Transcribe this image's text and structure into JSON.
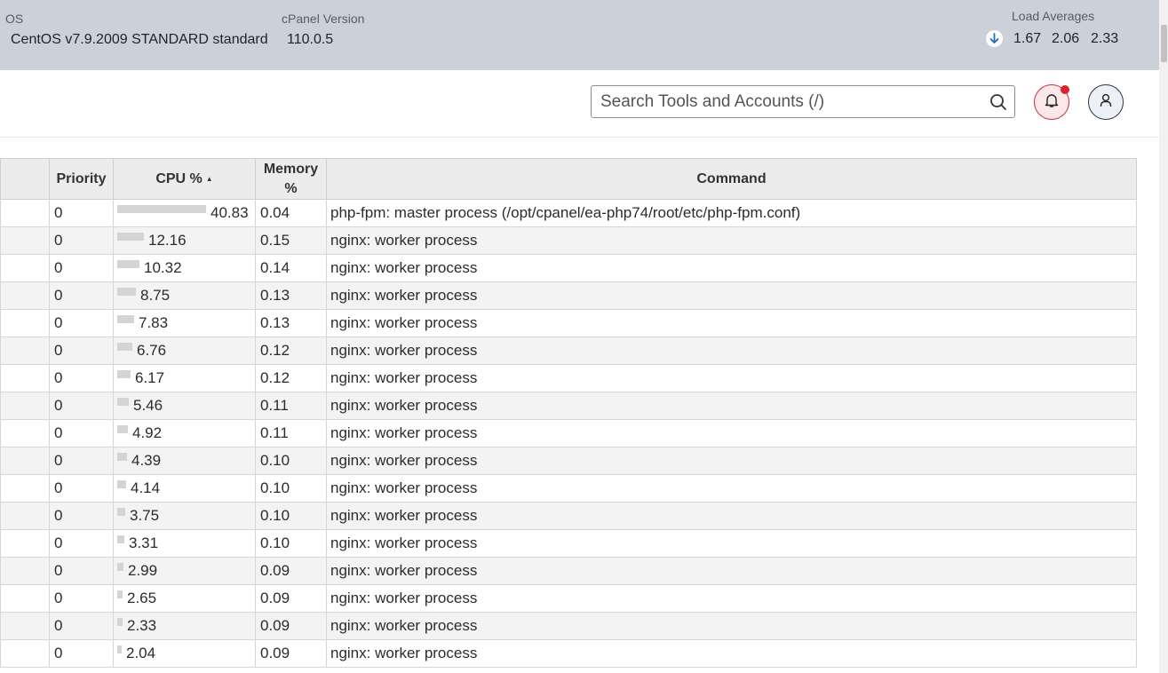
{
  "system": {
    "os_label": "OS",
    "os_value": "CentOS v7.9.2009 STANDARD standard",
    "cpanel_label": "cPanel Version",
    "cpanel_value": "110.0.5",
    "load_label": "Load Averages",
    "load_values": [
      "1.67",
      "2.06",
      "2.33"
    ],
    "load_trend_icon": "arrow-down-icon"
  },
  "header": {
    "search_placeholder": "Search Tools and Accounts (/)",
    "search_icon": "search-icon",
    "notifications_icon": "bell-icon",
    "user_icon": "user-icon"
  },
  "table": {
    "headers": {
      "priority": "Priority",
      "cpu": "CPU %",
      "cpu_sort_indicator": "▲",
      "memory": "Memory %",
      "command": "Command"
    },
    "rows": [
      {
        "priority": "0",
        "cpu": 40.83,
        "cpu_text": "40.83",
        "memory": "0.04",
        "command": "php-fpm: master process (/opt/cpanel/ea-php74/root/etc/php-fpm.conf)"
      },
      {
        "priority": "0",
        "cpu": 12.16,
        "cpu_text": "12.16",
        "memory": "0.15",
        "command": "nginx: worker process"
      },
      {
        "priority": "0",
        "cpu": 10.32,
        "cpu_text": "10.32",
        "memory": "0.14",
        "command": "nginx: worker process"
      },
      {
        "priority": "0",
        "cpu": 8.75,
        "cpu_text": "8.75",
        "memory": "0.13",
        "command": "nginx: worker process"
      },
      {
        "priority": "0",
        "cpu": 7.83,
        "cpu_text": "7.83",
        "memory": "0.13",
        "command": "nginx: worker process"
      },
      {
        "priority": "0",
        "cpu": 6.76,
        "cpu_text": "6.76",
        "memory": "0.12",
        "command": "nginx: worker process"
      },
      {
        "priority": "0",
        "cpu": 6.17,
        "cpu_text": "6.17",
        "memory": "0.12",
        "command": "nginx: worker process"
      },
      {
        "priority": "0",
        "cpu": 5.46,
        "cpu_text": "5.46",
        "memory": "0.11",
        "command": "nginx: worker process"
      },
      {
        "priority": "0",
        "cpu": 4.92,
        "cpu_text": "4.92",
        "memory": "0.11",
        "command": "nginx: worker process"
      },
      {
        "priority": "0",
        "cpu": 4.39,
        "cpu_text": "4.39",
        "memory": "0.10",
        "command": "nginx: worker process"
      },
      {
        "priority": "0",
        "cpu": 4.14,
        "cpu_text": "4.14",
        "memory": "0.10",
        "command": "nginx: worker process"
      },
      {
        "priority": "0",
        "cpu": 3.75,
        "cpu_text": "3.75",
        "memory": "0.10",
        "command": "nginx: worker process"
      },
      {
        "priority": "0",
        "cpu": 3.31,
        "cpu_text": "3.31",
        "memory": "0.10",
        "command": "nginx: worker process"
      },
      {
        "priority": "0",
        "cpu": 2.99,
        "cpu_text": "2.99",
        "memory": "0.09",
        "command": "nginx: worker process"
      },
      {
        "priority": "0",
        "cpu": 2.65,
        "cpu_text": "2.65",
        "memory": "0.09",
        "command": "nginx: worker process"
      },
      {
        "priority": "0",
        "cpu": 2.33,
        "cpu_text": "2.33",
        "memory": "0.09",
        "command": "nginx: worker process"
      },
      {
        "priority": "0",
        "cpu": 2.04,
        "cpu_text": "2.04",
        "memory": "0.09",
        "command": "nginx: worker process"
      }
    ]
  },
  "colors": {
    "topbar_bg": "#ccd0d8",
    "notification_accent": "#d9232d",
    "user_button_accent": "#2a3556",
    "cpu_bar": "#d4d4d4"
  }
}
